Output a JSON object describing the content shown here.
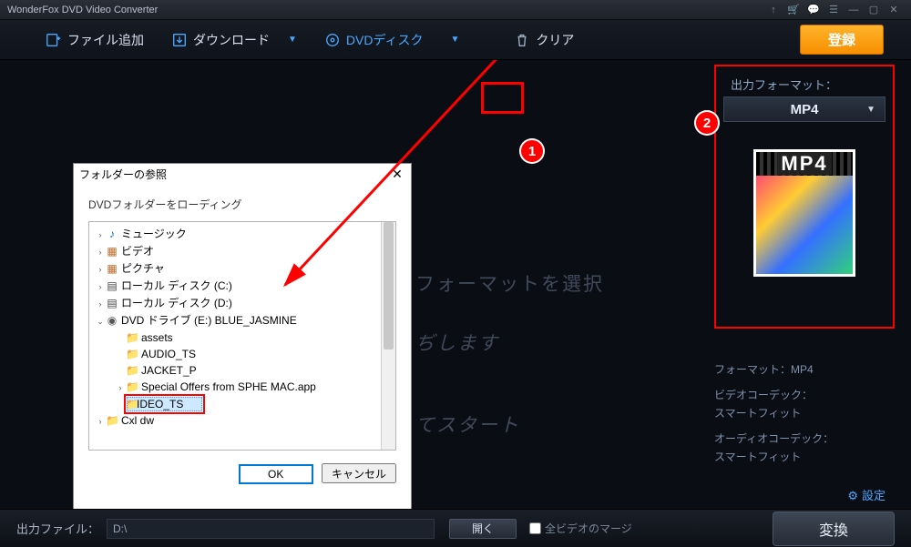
{
  "titlebar": {
    "title": "WonderFox DVD Video Converter"
  },
  "toolbar": {
    "add_file": "ファイル追加",
    "download": "ダウンロード",
    "dvd_disc": "DVDディスク",
    "clear": "クリア",
    "register": "登録"
  },
  "background": {
    "line1": "フォーマットを選択",
    "line2": "ぢします",
    "line3": "てスタート"
  },
  "output": {
    "panel_label": "出力フォーマット：",
    "format": "MP4",
    "thumb_text": "MP4",
    "meta": {
      "format_line": "フォーマット：MP4",
      "vcodec_label": "ビデオコーデック：",
      "vcodec_value": "スマートフィット",
      "acodec_label": "オーディオコーデック：",
      "acodec_value": "スマートフィット"
    },
    "settings": "設定"
  },
  "bottom": {
    "out_label": "出力ファイル：",
    "path": "D:\\",
    "open": "開く",
    "merge": "全ビデオのマージ",
    "convert": "変換"
  },
  "dialog": {
    "title": "フォルダーの参照",
    "instruction": "DVDフォルダーをローディング",
    "ok": "OK",
    "cancel": "キャンセル",
    "tree": {
      "items": [
        {
          "level": 1,
          "expand": "›",
          "icon": "♪",
          "color": "#0066ff",
          "label": "ミュージック"
        },
        {
          "level": 1,
          "expand": "›",
          "icon": "▦",
          "color": "#b86b2b",
          "label": "ビデオ"
        },
        {
          "level": 1,
          "expand": "›",
          "icon": "▦",
          "color": "#b86b2b",
          "label": "ピクチャ"
        },
        {
          "level": 1,
          "expand": "›",
          "icon": "▤",
          "color": "#444",
          "label": "ローカル ディスク (C:)"
        },
        {
          "level": 1,
          "expand": "›",
          "icon": "▤",
          "color": "#444",
          "label": "ローカル ディスク (D:)"
        },
        {
          "level": 1,
          "expand": "⌄",
          "icon": "◉",
          "color": "#555",
          "label": "DVD ドライブ (E:) BLUE_JASMINE"
        },
        {
          "level": 2,
          "expand": "",
          "icon": "📁",
          "color": "#e6c56b",
          "label": "assets"
        },
        {
          "level": 2,
          "expand": "",
          "icon": "📁",
          "color": "#e6c56b",
          "label": "AUDIO_TS"
        },
        {
          "level": 2,
          "expand": "",
          "icon": "📁",
          "color": "#e6c56b",
          "label": "JACKET_P"
        },
        {
          "level": 2,
          "expand": "›",
          "icon": "📁",
          "color": "#e6c56b",
          "label": "Special Offers from SPHE MAC.app"
        },
        {
          "level": 2,
          "expand": "",
          "icon": "📁",
          "color": "#e6c56b",
          "label": "VIDEO_TS",
          "selected": true,
          "redbox": true
        },
        {
          "level": 1,
          "expand": "›",
          "icon": "📁",
          "color": "#e6c56b",
          "label": "Cxl dw"
        }
      ]
    }
  },
  "annotations": {
    "callout1": "1",
    "callout2": "2"
  }
}
